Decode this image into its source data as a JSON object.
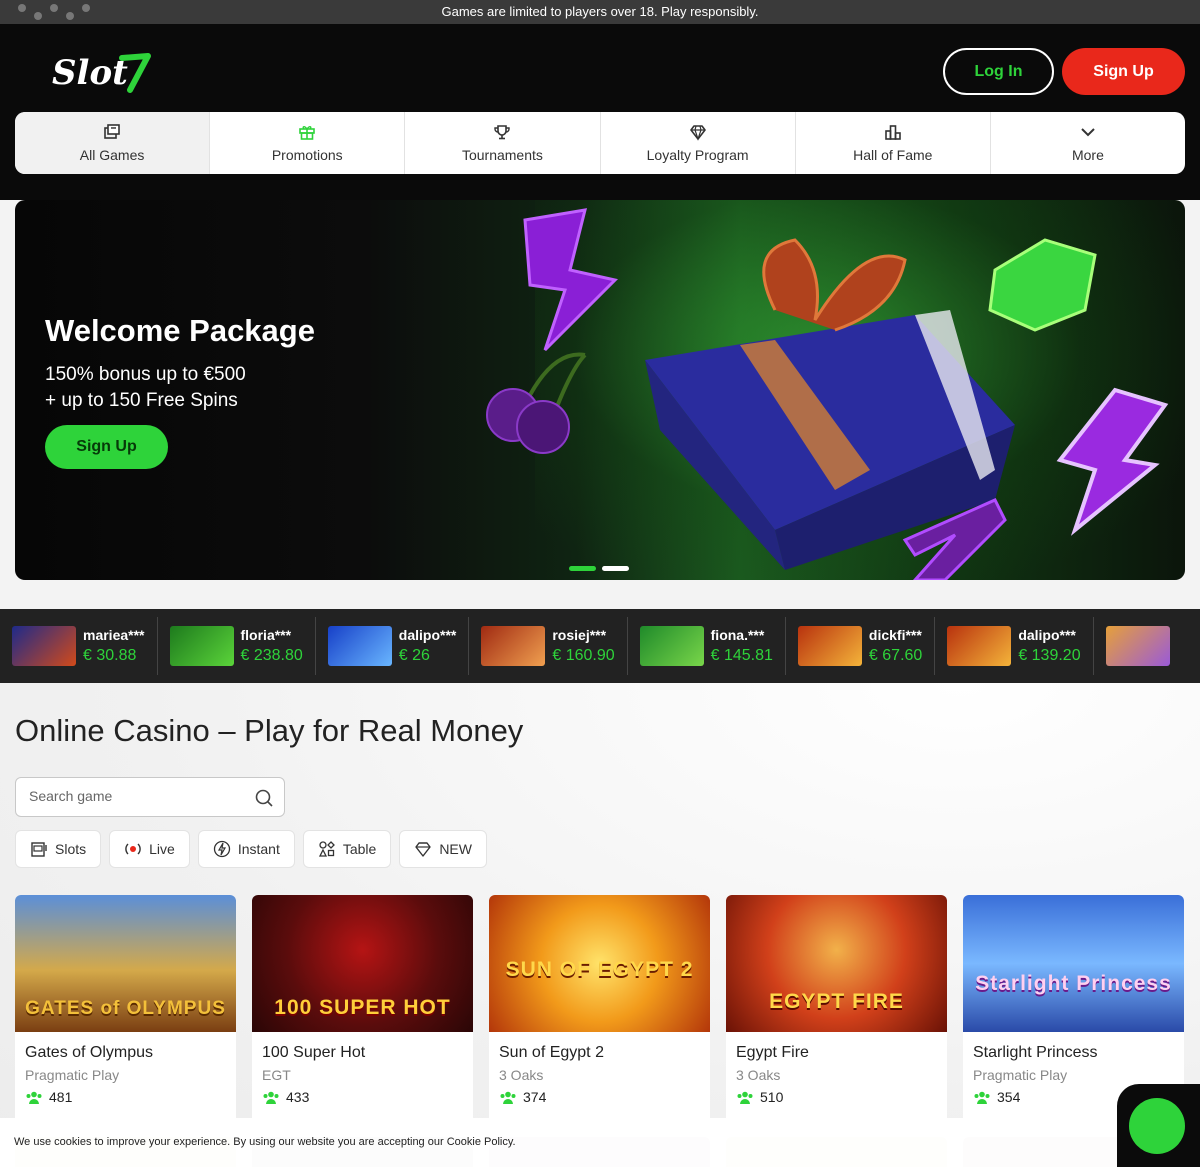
{
  "notice": {
    "text": "Games are limited to players over 18. Play responsibly."
  },
  "header": {
    "logo_text": "Slot7",
    "login_label": "Log In",
    "signup_label": "Sign Up"
  },
  "nav": {
    "items": [
      {
        "label": "All Games",
        "icon": "games-icon"
      },
      {
        "label": "Promotions",
        "icon": "gift-icon"
      },
      {
        "label": "Tournaments",
        "icon": "trophy-icon"
      },
      {
        "label": "Loyalty Program",
        "icon": "diamond-icon"
      },
      {
        "label": "Hall of Fame",
        "icon": "podium-icon"
      },
      {
        "label": "More",
        "icon": "chevron-down-icon"
      }
    ]
  },
  "hero": {
    "title": "Welcome Package",
    "line1": "150% bonus up to €500",
    "line2": "+ up to 150 Free Spins",
    "cta_label": "Sign Up"
  },
  "winners": [
    {
      "name": "mariea***",
      "amount": "€ 30.88"
    },
    {
      "name": "floria***",
      "amount": "€ 238.80"
    },
    {
      "name": "dalipo***",
      "amount": "€ 26"
    },
    {
      "name": "rosiej***",
      "amount": "€ 160.90"
    },
    {
      "name": "fiona.***",
      "amount": "€ 145.81"
    },
    {
      "name": "dickfi***",
      "amount": "€ 67.60"
    },
    {
      "name": "dalipo***",
      "amount": "€ 139.20"
    }
  ],
  "main": {
    "title": "Online Casino – Play for Real Money",
    "search_placeholder": "Search game",
    "categories": [
      {
        "label": "Slots",
        "icon": "slot-machine-icon"
      },
      {
        "label": "Live",
        "icon": "live-icon"
      },
      {
        "label": "Instant",
        "icon": "lightning-icon"
      },
      {
        "label": "Table",
        "icon": "cards-icon"
      },
      {
        "label": "NEW",
        "icon": "diamond-icon"
      }
    ]
  },
  "games": [
    {
      "title": "Gates of Olympus",
      "provider": "Pragmatic Play",
      "players": "481",
      "art_text": "GATES of OLYMPUS"
    },
    {
      "title": "100 Super Hot",
      "provider": "EGT",
      "players": "433",
      "art_text": "100 SUPER HOT"
    },
    {
      "title": "Sun of Egypt 2",
      "provider": "3 Oaks",
      "players": "374",
      "art_text": "SUN OF EGYPT 2"
    },
    {
      "title": "Egypt Fire",
      "provider": "3 Oaks",
      "players": "510",
      "art_text": "EGYPT FIRE"
    },
    {
      "title": "Starlight Princess",
      "provider": "Pragmatic Play",
      "players": "354",
      "art_text": "Starlight Princess"
    }
  ],
  "cookie": {
    "text": "We use cookies to improve your experience. By using our website you are accepting our Cookie Policy."
  },
  "colors": {
    "brand_green": "#2ed33a",
    "signup_red": "#e9281b",
    "header_bg": "#0a0a0a"
  }
}
